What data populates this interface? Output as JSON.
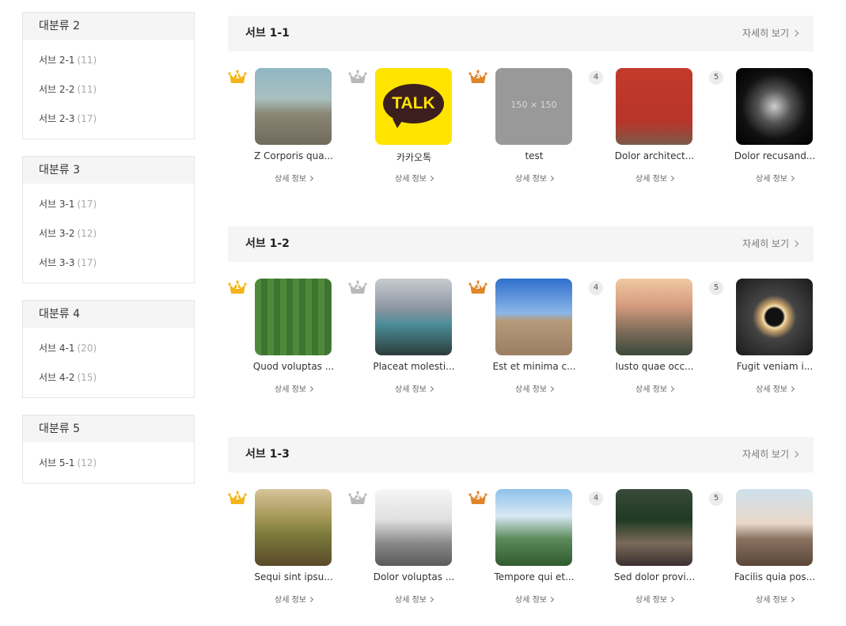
{
  "sidebar": {
    "categories": [
      {
        "title": "대분류 2",
        "items": [
          {
            "label": "서브 2-1",
            "count": "(11)"
          },
          {
            "label": "서브 2-2",
            "count": "(11)"
          },
          {
            "label": "서브 2-3",
            "count": "(17)"
          }
        ]
      },
      {
        "title": "대분류 3",
        "items": [
          {
            "label": "서브 3-1",
            "count": "(17)"
          },
          {
            "label": "서브 3-2",
            "count": "(12)"
          },
          {
            "label": "서브 3-3",
            "count": "(17)"
          }
        ]
      },
      {
        "title": "대분류 4",
        "items": [
          {
            "label": "서브 4-1",
            "count": "(20)"
          },
          {
            "label": "서브 4-2",
            "count": "(15)"
          }
        ]
      },
      {
        "title": "대분류 5",
        "items": [
          {
            "label": "서브 5-1",
            "count": "(12)"
          }
        ]
      }
    ]
  },
  "sections": [
    {
      "title": "서브 1-1",
      "more": "자세히 보기",
      "items": [
        {
          "rank": "1",
          "name": "Z Corporis qua...",
          "detail": "상세 정보"
        },
        {
          "rank": "2",
          "name": "카카오톡",
          "detail": "상세 정보",
          "thumb_text": "TALK"
        },
        {
          "rank": "3",
          "name": "test",
          "detail": "상세 정보",
          "thumb_text": "150 × 150"
        },
        {
          "rank": "4",
          "name": "Dolor architect...",
          "detail": "상세 정보"
        },
        {
          "rank": "5",
          "name": "Dolor recusand...",
          "detail": "상세 정보"
        }
      ]
    },
    {
      "title": "서브 1-2",
      "more": "자세히 보기",
      "items": [
        {
          "rank": "1",
          "name": "Quod voluptas ...",
          "detail": "상세 정보"
        },
        {
          "rank": "2",
          "name": "Placeat molesti...",
          "detail": "상세 정보"
        },
        {
          "rank": "3",
          "name": "Est et minima c...",
          "detail": "상세 정보"
        },
        {
          "rank": "4",
          "name": "Iusto quae occ...",
          "detail": "상세 정보"
        },
        {
          "rank": "5",
          "name": "Fugit veniam i...",
          "detail": "상세 정보"
        }
      ]
    },
    {
      "title": "서브 1-3",
      "more": "자세히 보기",
      "items": [
        {
          "rank": "1",
          "name": "Sequi sint ipsu...",
          "detail": "상세 정보"
        },
        {
          "rank": "2",
          "name": "Dolor voluptas ...",
          "detail": "상세 정보"
        },
        {
          "rank": "3",
          "name": "Tempore qui et...",
          "detail": "상세 정보"
        },
        {
          "rank": "4",
          "name": "Sed dolor provi...",
          "detail": "상세 정보"
        },
        {
          "rank": "5",
          "name": "Facilis quia pos...",
          "detail": "상세 정보"
        }
      ]
    }
  ],
  "colors": {
    "gold": "#f4b41a",
    "silver": "#b9b9b9",
    "bronze": "#e0852a",
    "header_bg": "#f5f5f5"
  }
}
